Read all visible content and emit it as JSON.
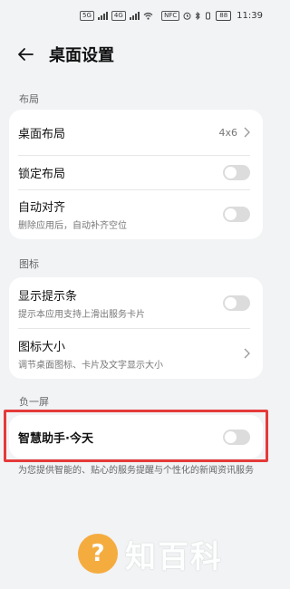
{
  "status_bar": {
    "left_badges": [
      "5G",
      "4G"
    ],
    "right_badge": "NFC",
    "battery": "88",
    "time": "11:39"
  },
  "header": {
    "title": "桌面设置",
    "back_icon": "arrow-left-icon"
  },
  "sections": {
    "layout": {
      "label": "布局",
      "rows": {
        "desktop_layout": {
          "title": "桌面布局",
          "value": "4x6"
        },
        "lock_layout": {
          "title": "锁定布局",
          "toggle_on": false
        },
        "auto_align": {
          "title": "自动对齐",
          "subtitle": "删除应用后，自动补齐空位",
          "toggle_on": false
        }
      }
    },
    "icons": {
      "label": "图标",
      "rows": {
        "show_badge": {
          "title": "显示提示条",
          "subtitle": "提示本应用支持上滑出服务卡片",
          "toggle_on": false
        },
        "icon_size": {
          "title": "图标大小",
          "subtitle": "调节桌面图标、卡片及文字显示大小"
        }
      }
    },
    "minus_one": {
      "label": "负一屏",
      "rows": {
        "smart_assistant": {
          "title": "智慧助手·今天",
          "toggle_on": false
        }
      },
      "footnote": "为您提供智能的、贴心的服务提醒与个性化的新闻资讯服务"
    }
  },
  "watermark": {
    "icon": "?",
    "text": "知百科"
  },
  "colors": {
    "background": "#f1f3f5",
    "card": "#ffffff",
    "highlight": "#e53a3a",
    "toggle_off": "#dcdcdc",
    "watermark_accent": "#f6a630"
  }
}
